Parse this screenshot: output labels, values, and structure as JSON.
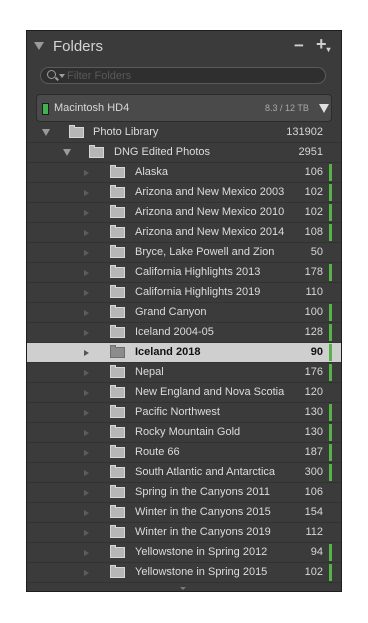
{
  "panel": {
    "title": "Folders",
    "minus_label": "−",
    "plus_label": "+",
    "plus_sub": "▾"
  },
  "search": {
    "placeholder": "Filter Folders"
  },
  "volume": {
    "name": "Macintosh HD4",
    "capacity": "8.3 / 12 TB",
    "status_color": "#3fb34f"
  },
  "tree": {
    "root": {
      "label": "Photo Library",
      "count": "131902"
    },
    "sub": {
      "label": "DNG Edited Photos",
      "count": "2951"
    },
    "folders": [
      {
        "label": "Alaska",
        "count": "106",
        "bar": true
      },
      {
        "label": "Arizona and New Mexico 2003",
        "count": "102",
        "bar": true
      },
      {
        "label": "Arizona and New Mexico 2010",
        "count": "102",
        "bar": true
      },
      {
        "label": "Arizona and New Mexico 2014",
        "count": "108",
        "bar": true
      },
      {
        "label": "Bryce, Lake Powell and Zion",
        "count": "50",
        "bar": false
      },
      {
        "label": "California Highlights 2013",
        "count": "178",
        "bar": true
      },
      {
        "label": "California Highlights 2019",
        "count": "110",
        "bar": false
      },
      {
        "label": "Grand Canyon",
        "count": "100",
        "bar": true
      },
      {
        "label": "Iceland 2004-05",
        "count": "128",
        "bar": true
      },
      {
        "label": "Iceland 2018",
        "count": "90",
        "bar": true,
        "selected": true
      },
      {
        "label": "Nepal",
        "count": "176",
        "bar": true
      },
      {
        "label": "New England and Nova Scotia",
        "count": "120",
        "bar": false
      },
      {
        "label": "Pacific Northwest",
        "count": "130",
        "bar": true
      },
      {
        "label": "Rocky Mountain Gold",
        "count": "130",
        "bar": true
      },
      {
        "label": "Route 66",
        "count": "187",
        "bar": true
      },
      {
        "label": "South Atlantic and Antarctica",
        "count": "300",
        "bar": true
      },
      {
        "label": "Spring in the Canyons 2011",
        "count": "106",
        "bar": false
      },
      {
        "label": "Winter in the Canyons 2015",
        "count": "154",
        "bar": false
      },
      {
        "label": "Winter in the Canyons 2019",
        "count": "112",
        "bar": false
      },
      {
        "label": "Yellowstone in Spring 2012",
        "count": "94",
        "bar": true
      },
      {
        "label": "Yellowstone in Spring 2015",
        "count": "102",
        "bar": true
      }
    ]
  },
  "colors": {
    "accent_bar": "#56b447",
    "panel_bg": "#3b3b3b",
    "selected_row": "#cfcfcf"
  }
}
